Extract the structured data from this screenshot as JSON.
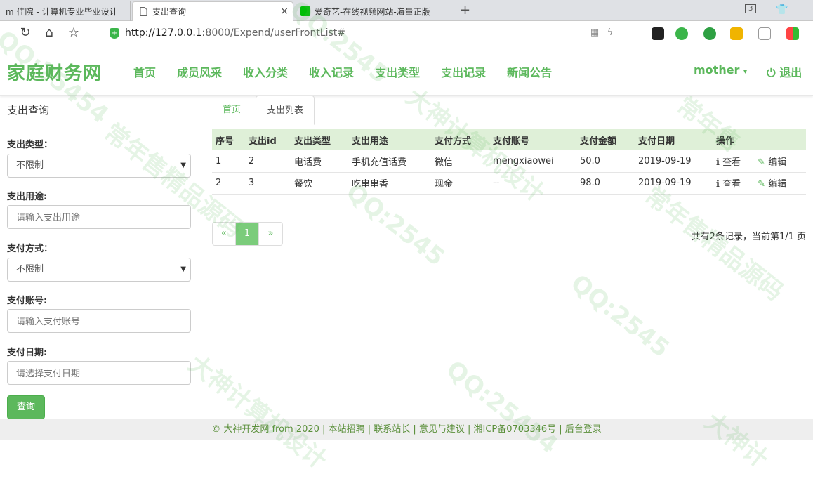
{
  "browser": {
    "tabs": [
      {
        "label": "m 佳院 - 计算机专业毕业设计"
      },
      {
        "label": "支出查询",
        "close": "×"
      },
      {
        "label": "爱奇艺-在线视频网站-海量正版"
      }
    ],
    "new_tab": "+",
    "tab_count": "3",
    "url_host": "http://127.0.0.1:",
    "url_rest": "8000/Expend/userFrontList#"
  },
  "header": {
    "brand": "家庭财务网",
    "nav": [
      "首页",
      "成员风采",
      "收入分类",
      "收入记录",
      "支出类型",
      "支出记录",
      "新闻公告"
    ],
    "user": "mother",
    "logout": "退出"
  },
  "search": {
    "title": "支出查询",
    "type_label": "支出类型：",
    "type_value": "不限制",
    "purpose_label": "支出用途:",
    "purpose_placeholder": "请输入支出用途",
    "method_label": "支付方式：",
    "method_value": "不限制",
    "account_label": "支付账号:",
    "account_placeholder": "请输入支付账号",
    "date_label": "支付日期:",
    "date_placeholder": "请选择支付日期",
    "submit": "查询"
  },
  "content": {
    "tabs": [
      "首页",
      "支出列表"
    ],
    "columns": [
      "序号",
      "支出id",
      "支出类型",
      "支出用途",
      "支付方式",
      "支付账号",
      "支付金额",
      "支付日期",
      "操作"
    ],
    "rows": [
      [
        "1",
        "2",
        "电话费",
        "手机充值话费",
        "微信",
        "mengxiaowei",
        "50.0",
        "2019-09-19"
      ],
      [
        "2",
        "3",
        "餐饮",
        "吃串串香",
        "现金",
        "--",
        "98.0",
        "2019-09-19"
      ]
    ],
    "view_label": "查看",
    "edit_label": "编辑",
    "pager": {
      "prev": "«",
      "current": "1",
      "next": "»"
    },
    "page_info": "共有2条记录，当前第1/1 页"
  },
  "footer": {
    "text": "© 大神开发网 from 2020 | 本站招聘 | 联系站长 | 意见与建议 | 湘ICP备0703346号 | 后台登录"
  },
  "colors": {
    "accent": "#5cb85c",
    "header_row": "#dff0d8"
  }
}
